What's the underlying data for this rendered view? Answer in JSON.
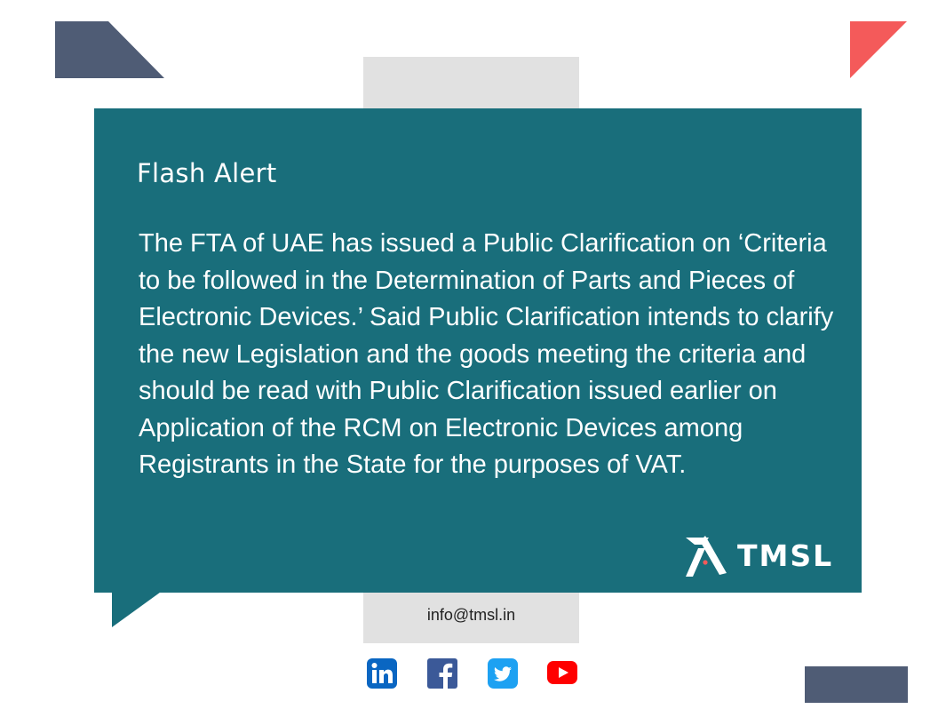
{
  "alert": {
    "heading": "Flash Alert",
    "body": "The FTA of UAE has issued a Public Clarification on ‘Criteria to be followed in the Determination of Parts and Pieces of Electronic Devices.’ Said Public Clarification intends to clarify the new Legislation and the goods meeting the criteria and should be read with Public Clarification issued earlier on Application of the RCM on Electronic Devices among Registrants in the State for the purposes of VAT."
  },
  "brand": {
    "name": "TMSL",
    "logo_icon": "tmsl-logo-icon"
  },
  "contact": {
    "email": "info@tmsl.in"
  },
  "social": [
    {
      "name": "LinkedIn",
      "icon": "linkedin-icon",
      "color": "#0a66c2"
    },
    {
      "name": "Facebook",
      "icon": "facebook-icon",
      "color": "#3b5998"
    },
    {
      "name": "Twitter",
      "icon": "twitter-icon",
      "color": "#1da1f2"
    },
    {
      "name": "YouTube",
      "icon": "youtube-icon",
      "color": "#ff0000"
    }
  ],
  "colors": {
    "card": "#196e7b",
    "slate": "#4f5c75",
    "coral": "#f45a5a",
    "grey": "#e1e1e1"
  }
}
